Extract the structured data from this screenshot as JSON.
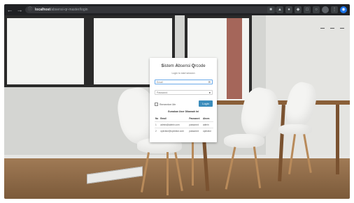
{
  "browser": {
    "url_host": "localhost",
    "url_path": "/absensi-qr-master/login",
    "icons": {
      "back": "arrow-left-icon",
      "forward": "arrow-right-icon",
      "reload": "reload-icon",
      "site_info": "info-icon"
    }
  },
  "login": {
    "title_parts": [
      {
        "initial": "S",
        "rest": "istem "
      },
      {
        "initial": "A",
        "rest": "bsensi "
      },
      {
        "initial": "Q",
        "rest": "rcode"
      }
    ],
    "subtitle": "Login to start session",
    "email_placeholder": "Email",
    "password_placeholder": "Password",
    "remember_label": "Remember Me",
    "login_button": "Login",
    "users_heading": "Gunakan User Dibawah Ini",
    "table_headers": [
      "No",
      "Email",
      "Password",
      "Akses"
    ],
    "users": [
      {
        "no": "1",
        "email": "admin@admin.com",
        "password": "password",
        "akses": "admin"
      },
      {
        "no": "2",
        "email": "operator@operator.com",
        "password": "password",
        "akses": "operator"
      }
    ],
    "accent_color": "#3c8dbc"
  }
}
